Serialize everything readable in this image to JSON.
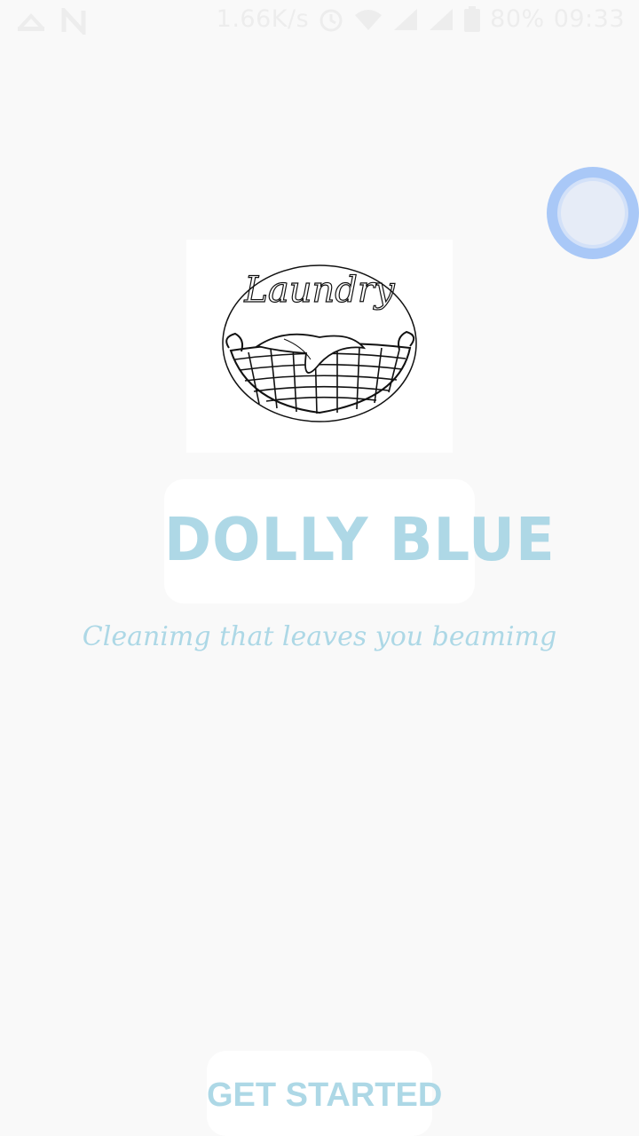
{
  "status_bar": {
    "net_speed": "1.66K/s",
    "battery": "80%",
    "time": "09:33",
    "icons": [
      "cast-icon",
      "n-notification-icon",
      "alarm-icon",
      "wifi-icon",
      "signal-icon",
      "signal-2-icon",
      "battery-icon"
    ]
  },
  "logo": {
    "image_text": "Laundry",
    "icon": "laundry-basket-icon"
  },
  "brand": {
    "title": "DOLLY BLUE",
    "color": "#add8e6"
  },
  "tagline": "Cleanimg that leaves you beamimg",
  "cta": {
    "label": "GET STARTED"
  },
  "floating_button": {
    "icon": "assistive-touch-icon",
    "color": "#a9c8f7"
  },
  "colors": {
    "background": "#f9f9f9",
    "accent": "#add8e6"
  }
}
